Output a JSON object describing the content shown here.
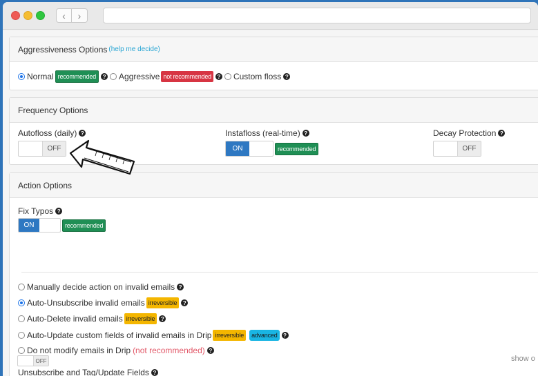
{
  "aggressiveness": {
    "title": "Aggressiveness Options",
    "help": "(help me decide)",
    "options": [
      {
        "label": "Normal",
        "badge": "recommended",
        "badge_color": "#1f8f55"
      },
      {
        "label": "Aggressive",
        "badge": "not recommended",
        "badge_color": "#d73543"
      },
      {
        "label": "Custom floss"
      }
    ],
    "selected": "Normal"
  },
  "frequency": {
    "title": "Frequency Options",
    "autofloss": {
      "label": "Autofloss (daily)",
      "state": "OFF"
    },
    "instafloss": {
      "label": "Instafloss (real-time)",
      "state": "ON",
      "badge": "recommended"
    },
    "decay": {
      "label": "Decay Protection",
      "state": "OFF"
    }
  },
  "action": {
    "title": "Action Options",
    "fix_typos": {
      "label": "Fix Typos",
      "state": "ON",
      "badge": "recommended"
    },
    "choices": [
      {
        "label": "Manually decide action on invalid emails"
      },
      {
        "label": "Auto-Unsubscribe invalid emails",
        "badges": [
          "irreversible"
        ]
      },
      {
        "label": "Auto-Delete invalid emails",
        "badges": [
          "irreversible"
        ]
      },
      {
        "label": "Auto-Update custom fields of invalid emails in Drip",
        "badges": [
          "irreversible",
          "advanced"
        ]
      },
      {
        "label": "Do not modify emails in Drip",
        "note": "(not recommended)"
      }
    ],
    "selected": "Auto-Unsubscribe invalid emails",
    "unsub": {
      "label": "Unsubscribe and Tag/Update Fields",
      "state": "OFF"
    },
    "show_text": "show o"
  },
  "colors": {
    "accent": "#2e78c2",
    "green": "#1f8f55",
    "red": "#d73543",
    "yellow": "#f4b600",
    "cyan": "#19b5e3"
  }
}
